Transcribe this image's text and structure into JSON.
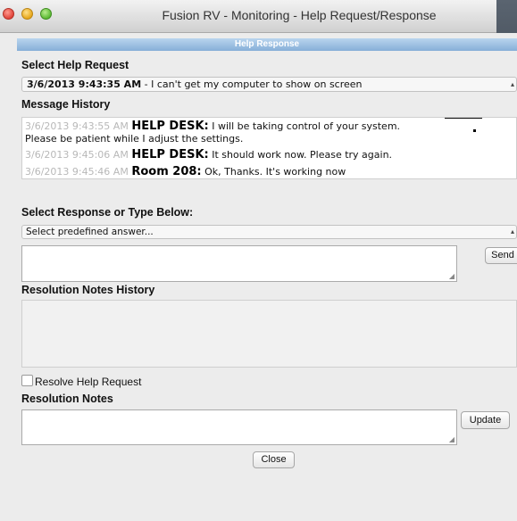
{
  "window": {
    "title": "Fusion RV - Monitoring - Help Request/Response"
  },
  "panel": {
    "header": "Help Response"
  },
  "help_request": {
    "label": "Select Help Request",
    "selected_datetime": "3/6/2013 9:43:35 AM",
    "selected_text": " - I can't get my computer to show on screen"
  },
  "message_history": {
    "label": "Message History",
    "messages": [
      {
        "timestamp": "3/6/2013 9:43:55 AM",
        "sender": "HELP DESK:",
        "text": " I will be taking control of your system.",
        "continuation": "Please be patient while I adjust the settings."
      },
      {
        "timestamp": "3/6/2013 9:45:06 AM",
        "sender": "HELP DESK:",
        "text": " It should work now. Please try again."
      },
      {
        "timestamp": "3/6/2013 9:45:46 AM",
        "sender": "Room 208:",
        "text": " Ok, Thanks. It's working now"
      }
    ]
  },
  "response": {
    "label": "Select Response or Type Below:",
    "predefined_placeholder": "Select predefined answer...",
    "send_label": "Send",
    "value": ""
  },
  "resolution_history": {
    "label": "Resolution Notes History"
  },
  "resolve": {
    "label": "Resolve Help Request",
    "checked": false
  },
  "resolution_notes": {
    "label": "Resolution Notes",
    "update_label": "Update",
    "value": ""
  },
  "footer": {
    "close_label": "Close"
  },
  "colors": {
    "panel_header": "#9bbfe3",
    "timestamp": "#b8b8b8",
    "close_light": "#e0443a",
    "minimize_light": "#e6a619",
    "maximize_light": "#5bb932"
  }
}
